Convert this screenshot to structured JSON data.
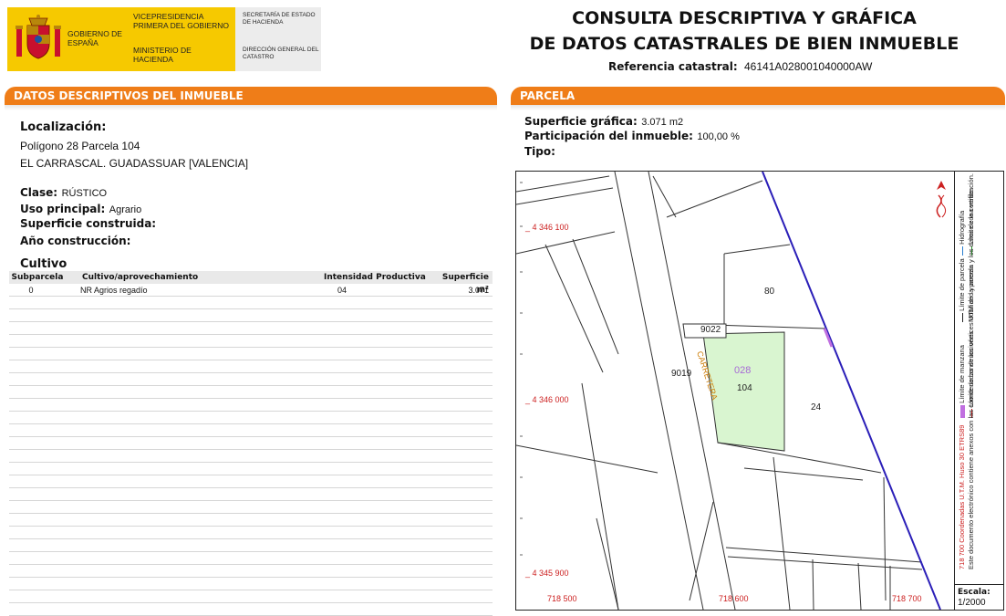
{
  "header": {
    "gobierno": "GOBIERNO DE ESPAÑA",
    "vicepresidencia": "VICEPRESIDENCIA PRIMERA DEL GOBIERNO",
    "ministerio": "MINISTERIO DE HACIENDA",
    "secretaria": "SECRETARÍA DE ESTADO DE HACIENDA",
    "direccion": "DIRECCIÓN GENERAL DEL CATASTRO",
    "title_line1": "CONSULTA DESCRIPTIVA Y GRÁFICA",
    "title_line2": "DE DATOS CATASTRALES DE BIEN INMUEBLE",
    "ref_label": "Referencia catastral:",
    "ref_value": "46141A028001040000AW"
  },
  "datos": {
    "section_title": "DATOS DESCRIPTIVOS DEL INMUEBLE",
    "localizacion_label": "Localización:",
    "localizacion_line1": "Polígono 28 Parcela 104",
    "localizacion_line2": "EL CARRASCAL. GUADASSUAR [VALENCIA]",
    "clase_label": "Clase:",
    "clase_value": "RÚSTICO",
    "uso_label": "Uso principal:",
    "uso_value": "Agrario",
    "superficie_construida_label": "Superficie construida:",
    "ano_label": "Año construcción:",
    "cultivo_label": "Cultivo",
    "table": {
      "columns": [
        "Subparcela",
        "Cultivo/aprovechamiento",
        "Intensidad Productiva",
        "Superficie m²"
      ],
      "rows": [
        {
          "subparcela": "0",
          "cultivo": "NR Agrios regadío",
          "intensidad": "04",
          "superficie": "3.071"
        }
      ]
    }
  },
  "parcela": {
    "section_title": "PARCELA",
    "superficie_label": "Superficie gráfica:",
    "superficie_value": "3.071 m2",
    "participacion_label": "Participación del inmueble:",
    "participacion_value": "100,00 %",
    "tipo_label": "Tipo:"
  },
  "map": {
    "coord_y": [
      "4 346 100",
      "4 346 000",
      "4 345 900"
    ],
    "coord_x": [
      "718 500",
      "718 600",
      "718 700"
    ],
    "parcel_labels": {
      "p80": "80",
      "p9022": "9022",
      "p9019": "9019",
      "poligono": "028",
      "parcela": "104",
      "p24": "24",
      "carretera": "CARRETERA"
    },
    "legend": {
      "limite_manzana": "Límite de manzana",
      "limite_construcciones": "Límite de construcciones",
      "limite_parcela": "Límite de parcela",
      "mobiliario": "Mobiliario y aceras",
      "hidrografia": "Hidrografía",
      "zona_verde": "Límite zona verde",
      "coordenadas": "718 700 Coordenadas U.T.M. Huso 30 ETRS89",
      "nota": "Este documento electrónico contiene anexos con las coordenadas de los vértices UTM de la parcela y los datos de la certificación."
    },
    "escala_label": "Escala:",
    "escala_value": "1/2000",
    "colors": {
      "parcel_fill": "#d9f5d0",
      "boundary": "#2b1fb8",
      "coords": "#cc2020",
      "section_bar": "#ef7d18"
    }
  }
}
